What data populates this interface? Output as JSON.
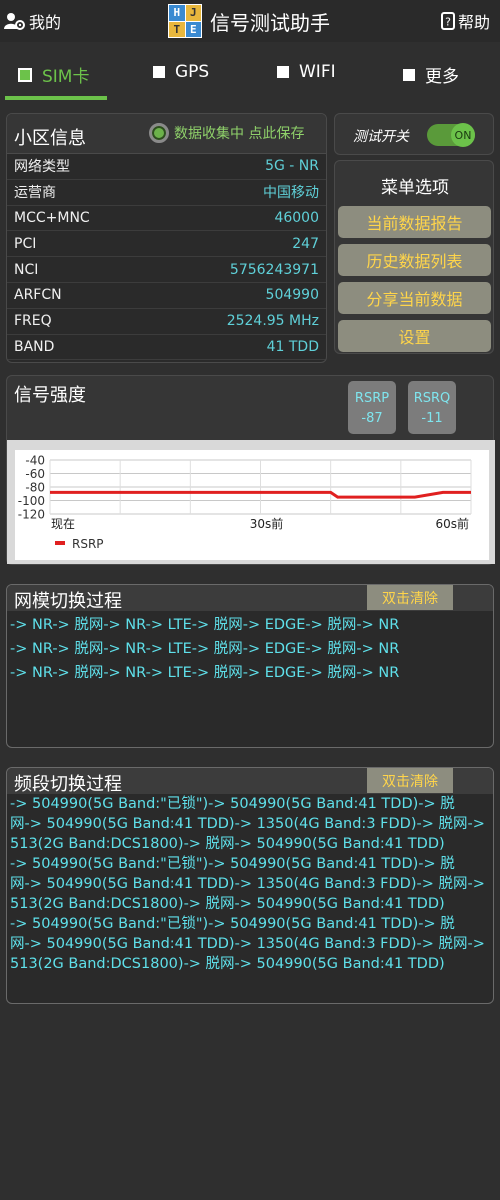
{
  "header": {
    "mine_label": "我的",
    "help_label": "帮助",
    "title": "信号测试助手",
    "logo_letters": [
      "H",
      "J",
      "T",
      "E"
    ]
  },
  "tabs": [
    {
      "label": "SIM卡",
      "active": true
    },
    {
      "label": "GPS",
      "active": false
    },
    {
      "label": "WIFI",
      "active": false
    },
    {
      "label": "更多",
      "active": false
    }
  ],
  "cell_info": {
    "title": "小区信息",
    "collect_status": "数据收集中 点此保存",
    "rows": [
      {
        "key": "网络类型",
        "value": "5G - NR"
      },
      {
        "key": "运营商",
        "value": "中国移动"
      },
      {
        "key": "MCC+MNC",
        "value": "46000"
      },
      {
        "key": "PCI",
        "value": "247"
      },
      {
        "key": "NCI",
        "value": "5756243971"
      },
      {
        "key": "ARFCN",
        "value": "504990"
      },
      {
        "key": "FREQ",
        "value": "2524.95 MHz"
      },
      {
        "key": "BAND",
        "value": "41 TDD"
      }
    ]
  },
  "test_switch": {
    "label": "测试开关",
    "state": "ON"
  },
  "menu": {
    "title": "菜单选项",
    "items": [
      "当前数据报告",
      "历史数据列表",
      "分享当前数据",
      "设置"
    ]
  },
  "signal": {
    "title": "信号强度",
    "rsrp_label": "RSRP",
    "rsrp_value": "-87",
    "rsrq_label": "RSRQ",
    "rsrq_value": "-11"
  },
  "chart_data": {
    "type": "line",
    "y_ticks": [
      "-40",
      "-60",
      "-80",
      "-100",
      "-120"
    ],
    "ylim": [
      -120,
      -40
    ],
    "x_ticks": [
      "现在",
      "30s前",
      "60s前"
    ],
    "series": [
      {
        "name": "RSRP",
        "color": "#e02020",
        "x": [
          0,
          6,
          12,
          18,
          24,
          30,
          36,
          40,
          41,
          44,
          48,
          52,
          56,
          58,
          60
        ],
        "values": [
          -88,
          -88,
          -88,
          -88,
          -88,
          -88,
          -88,
          -88,
          -95,
          -95,
          -95,
          -95,
          -88,
          -88,
          -88
        ]
      }
    ],
    "grid": true,
    "legend": "bottom-left"
  },
  "net_mode": {
    "title": "网模切换过程",
    "clear_label": "双击清除",
    "lines": [
      "-> NR-> 脱网-> NR-> LTE-> 脱网-> EDGE-> 脱网-> NR",
      "-> NR-> 脱网-> NR-> LTE-> 脱网-> EDGE-> 脱网-> NR",
      "-> NR-> 脱网-> NR-> LTE-> 脱网-> EDGE-> 脱网-> NR"
    ]
  },
  "band": {
    "title": "频段切换过程",
    "clear_label": "双击清除",
    "lines": [
      "-> 504990(5G Band:\"已锁\")-> 504990(5G Band:41 TDD)-> 脱",
      "网-> 504990(5G Band:41 TDD)-> 1350(4G Band:3 FDD)-> 脱网->",
      "513(2G Band:DCS1800)-> 脱网-> 504990(5G Band:41 TDD)",
      "-> 504990(5G Band:\"已锁\")-> 504990(5G Band:41 TDD)-> 脱",
      "网-> 504990(5G Band:41 TDD)-> 1350(4G Band:3 FDD)-> 脱网->",
      "513(2G Band:DCS1800)-> 脱网-> 504990(5G Band:41 TDD)",
      "-> 504990(5G Band:\"已锁\")-> 504990(5G Band:41 TDD)-> 脱",
      "网-> 504990(5G Band:41 TDD)-> 1350(4G Band:3 FDD)-> 脱网->",
      "513(2G Band:DCS1800)-> 脱网-> 504990(5G Band:41 TDD)"
    ]
  }
}
